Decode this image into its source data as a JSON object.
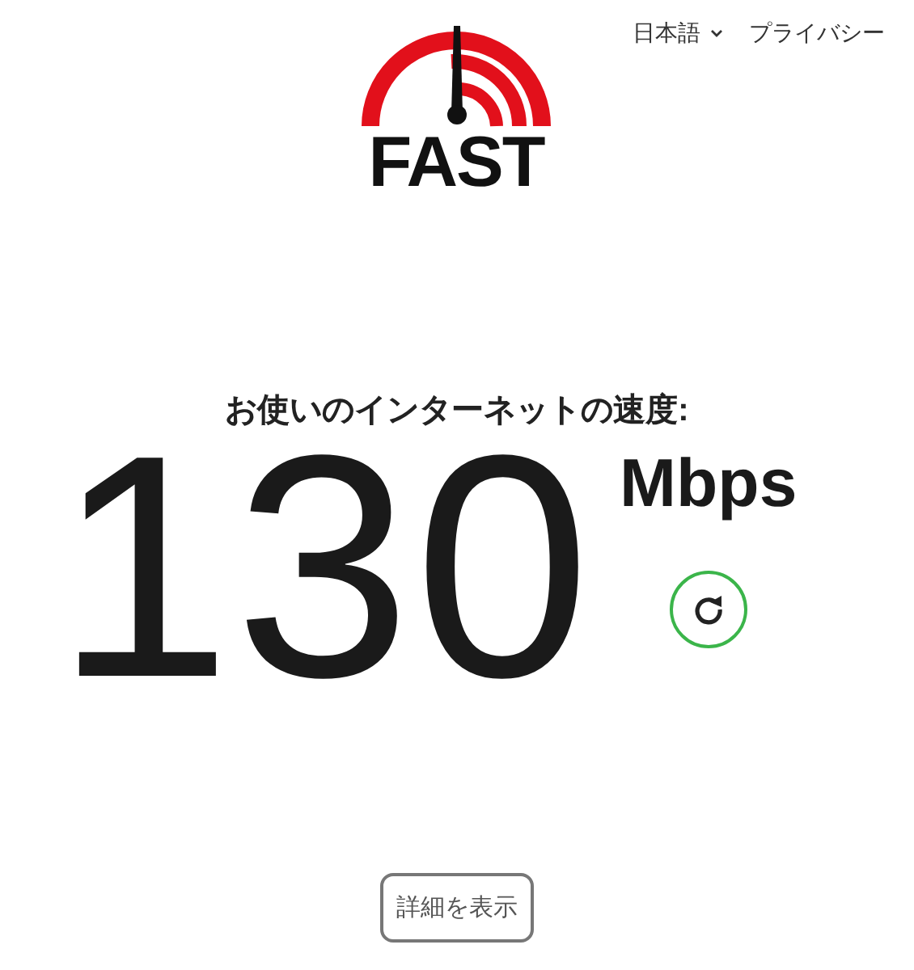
{
  "nav": {
    "language": "日本語",
    "privacy": "プライバシー"
  },
  "logo": {
    "text": "FAST"
  },
  "result": {
    "heading": "お使いのインターネットの速度:",
    "speed": "130",
    "unit": "Mbps"
  },
  "details_button": "詳細を表示"
}
